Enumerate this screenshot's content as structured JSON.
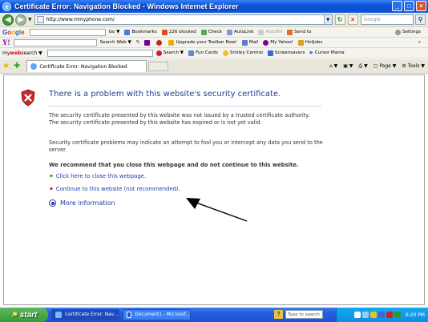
{
  "window": {
    "title": "Certificate Error: Navigation Blocked - Windows Internet Explorer"
  },
  "address_bar": {
    "url": "http://www.mmyphone.com/",
    "search_placeholder": "Google"
  },
  "toolbar_google": {
    "label": "Google",
    "go": "Go",
    "bookmarks": "Bookmarks",
    "blocked": "226 blocked",
    "check": "Check",
    "autolink": "AutoLink",
    "autofill": "AutoFill",
    "sendto": "Send to",
    "settings": "Settings"
  },
  "toolbar_yahoo": {
    "search_web": "Search Web",
    "upgrade": "Upgrade your Toolbar Now!",
    "mail": "Mail",
    "my_yahoo": "My Yahoo!",
    "hotjobs": "HotJobs"
  },
  "toolbar_mws": {
    "brand_a": "my",
    "brand_b": "web",
    "brand_c": "search",
    "search": "Search",
    "fun_cards": "Fun Cards",
    "smiley": "Smiley Central",
    "screensavers": "Screensavers",
    "cursor": "Cursor Mania"
  },
  "tabs": [
    {
      "label": "Certificate Error: Navigation Blocked"
    }
  ],
  "command_bar": {
    "page": "Page",
    "tools": "Tools"
  },
  "content": {
    "heading": "There is a problem with this website's security certificate.",
    "para1_line1": "The security certificate presented by this website was not issued by a trusted certificate authority.",
    "para1_line2": "The security certificate presented by this website has expired or is not yet valid.",
    "para2": "Security certificate problems may indicate an attempt to fool you or intercept any data you send to the server.",
    "recommendation": "We recommend that you close this webpage and do not continue to this website.",
    "close_link": "Click here to close this webpage.",
    "continue_link": "Continue to this website (not recommended).",
    "more_info": "More information"
  },
  "taskbar": {
    "start": "start",
    "tasks": [
      {
        "label": "Certificate Error: Nav..."
      },
      {
        "label": "Document1 - Microsof..."
      }
    ],
    "search_box": "Type to search",
    "clock": "6:20 PM"
  },
  "colors": {
    "title_blue": "#0b55d9",
    "link_blue": "#1a3da8",
    "heading_blue": "#1f3f8f",
    "shield_red": "#c8282a"
  }
}
